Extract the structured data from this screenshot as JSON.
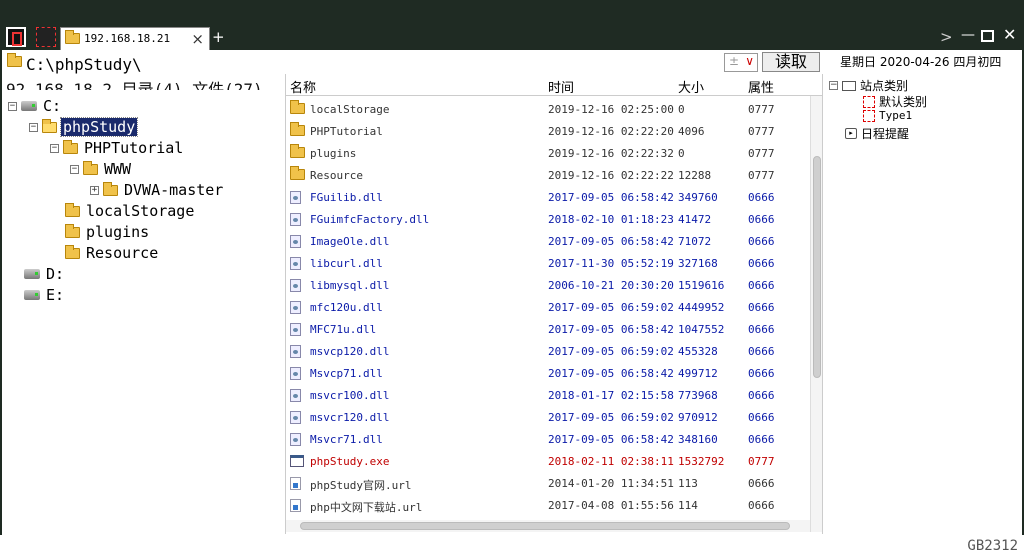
{
  "tab": {
    "title": "192.168.18.21",
    "close": "×",
    "add": "+"
  },
  "window": {
    "forward": ">",
    "minimize": "—",
    "close": "✕"
  },
  "address": {
    "path": "C:\\phpStudy\\",
    "dropdown_value": "±",
    "read_button": "读取",
    "date": "星期日  2020-04-26  四月初四"
  },
  "stats": "92.168.18.2  目录(4)  文件(27)",
  "tree": {
    "c_drive": "C:",
    "phpstudy": "phpStudy",
    "phptutorial": "PHPTutorial",
    "www": "WWW",
    "dvwa": "DVWA-master",
    "localstorage": "localStorage",
    "plugins": "plugins",
    "resource": "Resource",
    "d_drive": "D:",
    "e_drive": "E:"
  },
  "list": {
    "headers": {
      "name": "名称",
      "time": "时间",
      "size": "大小",
      "attr": "属性"
    },
    "rows": [
      {
        "type": "dir",
        "name": "localStorage",
        "time": "2019-12-16 02:25:00",
        "size": "0",
        "attr": "0777"
      },
      {
        "type": "dir",
        "name": "PHPTutorial",
        "time": "2019-12-16 02:22:20",
        "size": "4096",
        "attr": "0777"
      },
      {
        "type": "dir",
        "name": "plugins",
        "time": "2019-12-16 02:22:32",
        "size": "0",
        "attr": "0777"
      },
      {
        "type": "dir",
        "name": "Resource",
        "time": "2019-12-16 02:22:22",
        "size": "12288",
        "attr": "0777"
      },
      {
        "type": "dll",
        "name": "FGuilib.dll",
        "time": "2017-09-05 06:58:42",
        "size": "349760",
        "attr": "0666"
      },
      {
        "type": "dll",
        "name": "FGuimfcFactory.dll",
        "time": "2018-02-10 01:18:23",
        "size": "41472",
        "attr": "0666"
      },
      {
        "type": "dll",
        "name": "ImageOle.dll",
        "time": "2017-09-05 06:58:42",
        "size": "71072",
        "attr": "0666"
      },
      {
        "type": "dll",
        "name": "libcurl.dll",
        "time": "2017-11-30 05:52:19",
        "size": "327168",
        "attr": "0666"
      },
      {
        "type": "dll",
        "name": "libmysql.dll",
        "time": "2006-10-21 20:30:20",
        "size": "1519616",
        "attr": "0666"
      },
      {
        "type": "dll",
        "name": "mfc120u.dll",
        "time": "2017-09-05 06:59:02",
        "size": "4449952",
        "attr": "0666"
      },
      {
        "type": "dll",
        "name": "MFC71u.dll",
        "time": "2017-09-05 06:58:42",
        "size": "1047552",
        "attr": "0666"
      },
      {
        "type": "dll",
        "name": "msvcp120.dll",
        "time": "2017-09-05 06:59:02",
        "size": "455328",
        "attr": "0666"
      },
      {
        "type": "dll",
        "name": "Msvcp71.dll",
        "time": "2017-09-05 06:58:42",
        "size": "499712",
        "attr": "0666"
      },
      {
        "type": "dll",
        "name": "msvcr100.dll",
        "time": "2018-01-17 02:15:58",
        "size": "773968",
        "attr": "0666"
      },
      {
        "type": "dll",
        "name": "msvcr120.dll",
        "time": "2017-09-05 06:59:02",
        "size": "970912",
        "attr": "0666"
      },
      {
        "type": "dll",
        "name": "Msvcr71.dll",
        "time": "2017-09-05 06:58:42",
        "size": "348160",
        "attr": "0666"
      },
      {
        "type": "exe",
        "name": "phpStudy.exe",
        "time": "2018-02-11 02:38:11",
        "size": "1532792",
        "attr": "0777"
      },
      {
        "type": "url",
        "name": "phpStudy官网.url",
        "time": "2014-01-20 11:34:51",
        "size": "113",
        "attr": "0666"
      },
      {
        "type": "url",
        "name": "php中文网下载站.url",
        "time": "2017-04-08 01:55:56",
        "size": "114",
        "attr": "0666"
      }
    ]
  },
  "right_panel": {
    "site_category": "站点类别",
    "default_category": "默认类别",
    "type1": "Type1",
    "schedule": "日程提醒"
  },
  "status": {
    "encoding": "GB2312"
  },
  "colors": {
    "dll_text": "#0a1aa8",
    "exe_text": "#c00000",
    "selection": "#1a2a6c",
    "titlebar": "#1f2b23"
  }
}
